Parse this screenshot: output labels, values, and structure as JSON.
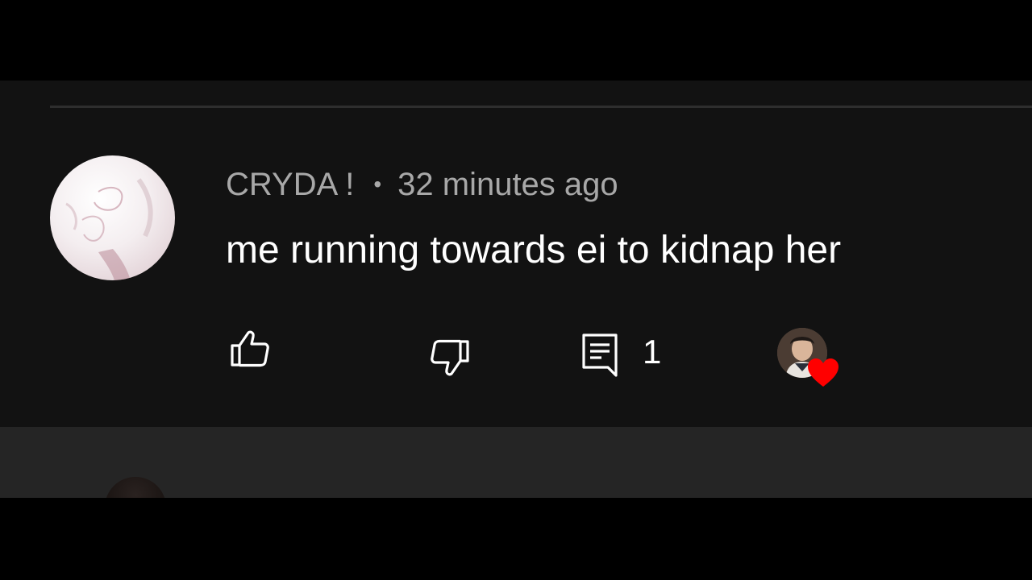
{
  "comment": {
    "author": "CRYDA !",
    "separator": "•",
    "timestamp": "32 minutes ago",
    "text": "me running towards ei to kidnap her",
    "reply_count": "1",
    "liked_by_creator": true
  },
  "colors": {
    "background": "#121212",
    "author_text": "#a8a8a8",
    "comment_text": "#ffffff",
    "heart": "#ff0000"
  },
  "icons": {
    "like": "thumbs-up-icon",
    "dislike": "thumbs-down-icon",
    "reply": "reply-icon",
    "heart": "heart-icon"
  }
}
